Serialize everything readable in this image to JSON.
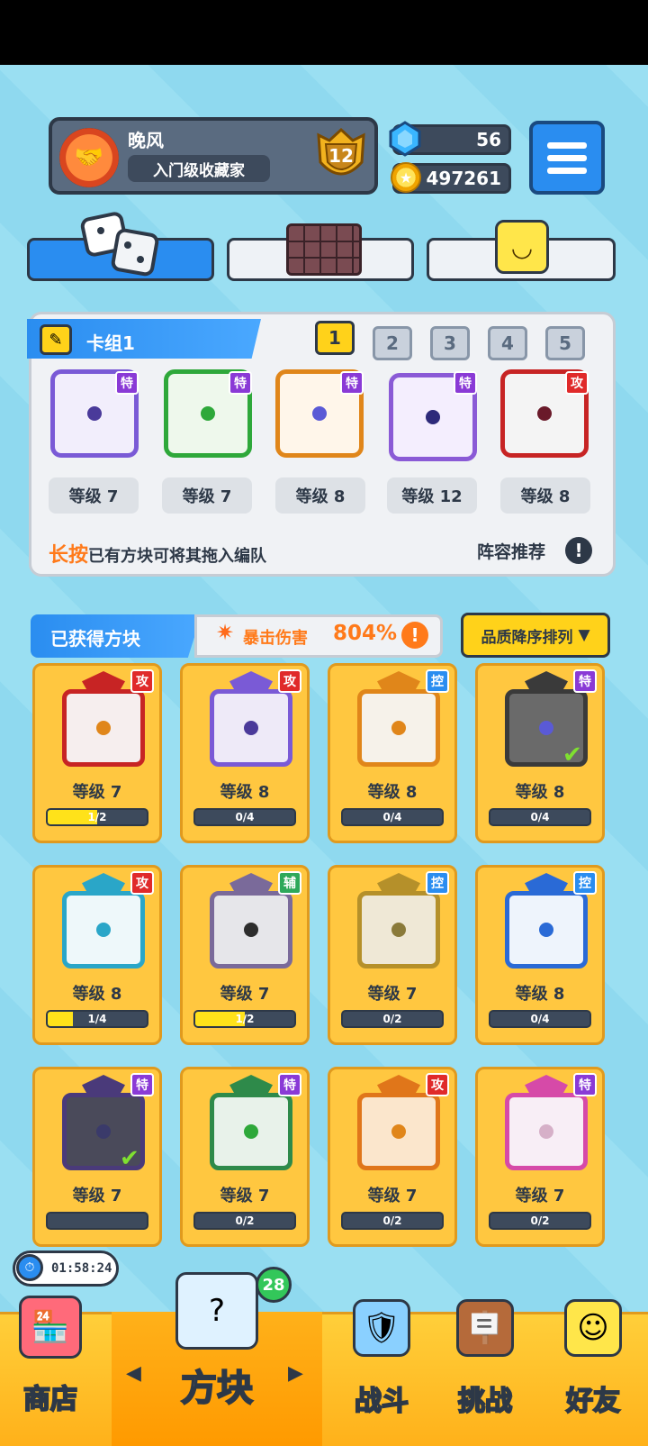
{
  "player": {
    "name": "晚风",
    "title": "入门级收藏家",
    "rank": "12"
  },
  "currency": {
    "gems": "56",
    "coins": "497261"
  },
  "deck": {
    "name": "卡组1",
    "slots": [
      "1",
      "2",
      "3",
      "4",
      "5"
    ],
    "active_slot": "1",
    "cards": [
      {
        "tag": "特",
        "level": "等级 7"
      },
      {
        "tag": "特",
        "level": "等级 7"
      },
      {
        "tag": "特",
        "level": "等级 8"
      },
      {
        "tag": "特",
        "level": "等级 12"
      },
      {
        "tag": "攻",
        "level": "等级 8"
      }
    ],
    "hint_accent": "长按",
    "hint_rest": "已有方块可将其拖入编队",
    "recommend": "阵容推荐"
  },
  "collection": {
    "header": "已获得方块",
    "crit_label": "暴击伤害",
    "crit_value": "804%",
    "sort_label": "品质降序排列",
    "cards": [
      {
        "tag": "攻",
        "level": "等级 7",
        "progress": "1/2"
      },
      {
        "tag": "攻",
        "level": "等级 8",
        "progress": "0/4"
      },
      {
        "tag": "控",
        "level": "等级 8",
        "progress": "0/4"
      },
      {
        "tag": "特",
        "level": "等级 8",
        "progress": "0/4"
      },
      {
        "tag": "攻",
        "level": "等级 8",
        "progress": "1/4"
      },
      {
        "tag": "辅",
        "level": "等级 7",
        "progress": "1/2"
      },
      {
        "tag": "控",
        "level": "等级 7",
        "progress": "0/2"
      },
      {
        "tag": "控",
        "level": "等级 8",
        "progress": "0/4"
      },
      {
        "tag": "特",
        "level": "等级 7",
        "progress": ""
      },
      {
        "tag": "特",
        "level": "等级 7",
        "progress": "0/2"
      },
      {
        "tag": "攻",
        "level": "等级 7",
        "progress": "0/2"
      },
      {
        "tag": "特",
        "level": "等级 7",
        "progress": "0/2"
      }
    ]
  },
  "timer": "01:58:24",
  "nav": {
    "shop": "商店",
    "block": "方块",
    "battle": "战斗",
    "challenge": "挑战",
    "friends": "好友",
    "badge": "28"
  },
  "colors": {
    "attack_tag": "#e02a2a",
    "special_tag": "#8a3ad6",
    "control_tag": "#2a8df0",
    "support_tag": "#2ea85a",
    "accent_orange": "#ff7a1a",
    "primary_blue": "#2a8df0"
  }
}
